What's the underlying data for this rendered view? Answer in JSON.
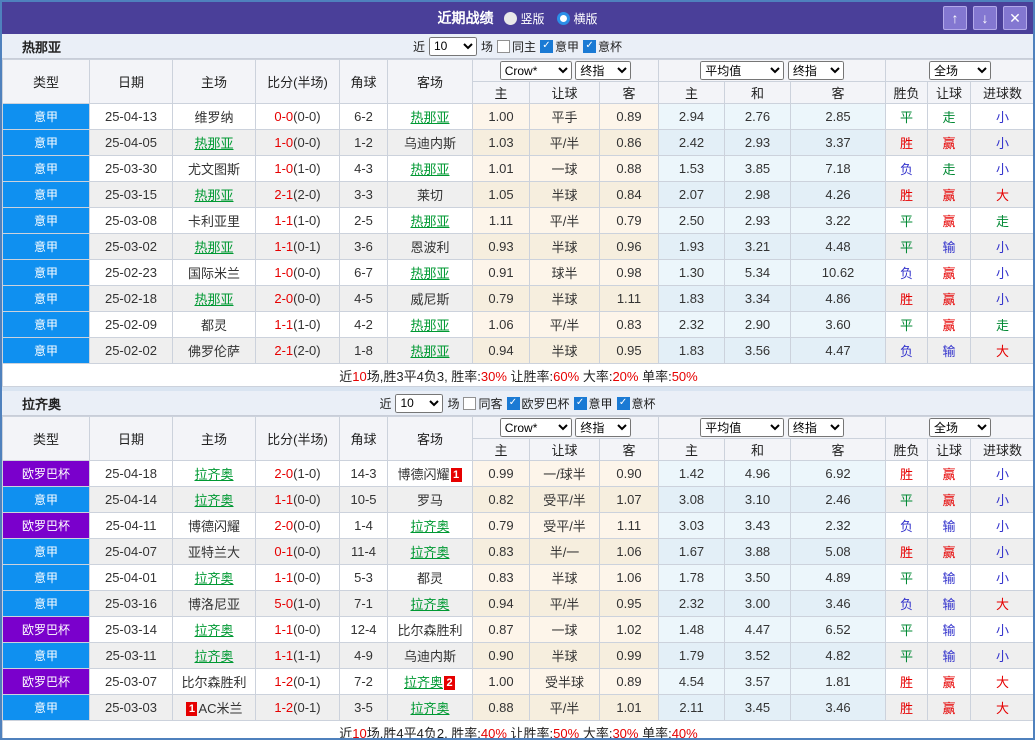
{
  "titlebar": {
    "title": "近期战绩",
    "radios": [
      {
        "label": "竖版",
        "checked": false
      },
      {
        "label": "横版",
        "checked": true
      }
    ],
    "buttons": [
      {
        "name": "move-up",
        "glyph": "↑"
      },
      {
        "name": "move-down",
        "glyph": "↓"
      },
      {
        "name": "close",
        "glyph": "✕"
      }
    ]
  },
  "columns": [
    "类型",
    "日期",
    "主场",
    "比分(半场)",
    "角球",
    "客场",
    "主",
    "让球",
    "客",
    "主",
    "和",
    "客",
    "胜负",
    "让球",
    "进球数"
  ],
  "header_dropdowns": {
    "odds_source": "Crow*",
    "odds_stage": "终指",
    "avg_source": "平均值",
    "avg_stage": "终指",
    "result_scope": "全场"
  },
  "type_colors": {
    "意甲": "#0f90f0",
    "欧罗巴杯": "#7a00cc"
  },
  "status_colors": {
    "r": "#e60000",
    "g": "#008833",
    "b": "#3333cc",
    "team_focus": "#009933"
  },
  "sections": [
    {
      "team": "热那亚",
      "filter": {
        "prefix": "近",
        "count": "10",
        "suffix": "场",
        "checkboxes": [
          {
            "label": "同主",
            "checked": false
          },
          {
            "label": "意甲",
            "checked": true
          },
          {
            "label": "意杯",
            "checked": true
          }
        ]
      },
      "rows": [
        {
          "type": "意甲",
          "date": "25-04-13",
          "home": {
            "n": "维罗纳"
          },
          "score": "0-0",
          "half": "(0-0)",
          "corner": "6-2",
          "away": {
            "n": "热那亚",
            "f": 1
          },
          "odds": [
            "1.00",
            "平手",
            "0.89"
          ],
          "avg": [
            "2.94",
            "2.76",
            "2.85"
          ],
          "res": [
            [
              "平",
              "g"
            ],
            [
              "走",
              "g"
            ],
            [
              "小",
              "b"
            ]
          ]
        },
        {
          "type": "意甲",
          "date": "25-04-05",
          "home": {
            "n": "热那亚",
            "f": 1
          },
          "score": "1-0",
          "half": "(0-0)",
          "corner": "1-2",
          "away": {
            "n": "乌迪内斯"
          },
          "odds": [
            "1.03",
            "平/半",
            "0.86"
          ],
          "avg": [
            "2.42",
            "2.93",
            "3.37"
          ],
          "res": [
            [
              "胜",
              "r"
            ],
            [
              "赢",
              "r"
            ],
            [
              "小",
              "b"
            ]
          ]
        },
        {
          "type": "意甲",
          "date": "25-03-30",
          "home": {
            "n": "尤文图斯"
          },
          "score": "1-0",
          "half": "(1-0)",
          "corner": "4-3",
          "away": {
            "n": "热那亚",
            "f": 1
          },
          "odds": [
            "1.01",
            "一球",
            "0.88"
          ],
          "avg": [
            "1.53",
            "3.85",
            "7.18"
          ],
          "res": [
            [
              "负",
              "b"
            ],
            [
              "走",
              "g"
            ],
            [
              "小",
              "b"
            ]
          ]
        },
        {
          "type": "意甲",
          "date": "25-03-15",
          "home": {
            "n": "热那亚",
            "f": 1
          },
          "score": "2-1",
          "half": "(2-0)",
          "corner": "3-3",
          "away": {
            "n": "莱切"
          },
          "odds": [
            "1.05",
            "半球",
            "0.84"
          ],
          "avg": [
            "2.07",
            "2.98",
            "4.26"
          ],
          "res": [
            [
              "胜",
              "r"
            ],
            [
              "赢",
              "r"
            ],
            [
              "大",
              "r"
            ]
          ]
        },
        {
          "type": "意甲",
          "date": "25-03-08",
          "home": {
            "n": "卡利亚里"
          },
          "score": "1-1",
          "half": "(1-0)",
          "corner": "2-5",
          "away": {
            "n": "热那亚",
            "f": 1
          },
          "odds": [
            "1.11",
            "平/半",
            "0.79"
          ],
          "avg": [
            "2.50",
            "2.93",
            "3.22"
          ],
          "res": [
            [
              "平",
              "g"
            ],
            [
              "赢",
              "r"
            ],
            [
              "走",
              "g"
            ]
          ]
        },
        {
          "type": "意甲",
          "date": "25-03-02",
          "home": {
            "n": "热那亚",
            "f": 1
          },
          "score": "1-1",
          "half": "(0-1)",
          "corner": "3-6",
          "away": {
            "n": "恩波利"
          },
          "odds": [
            "0.93",
            "半球",
            "0.96"
          ],
          "avg": [
            "1.93",
            "3.21",
            "4.48"
          ],
          "res": [
            [
              "平",
              "g"
            ],
            [
              "输",
              "b"
            ],
            [
              "小",
              "b"
            ]
          ]
        },
        {
          "type": "意甲",
          "date": "25-02-23",
          "home": {
            "n": "国际米兰"
          },
          "score": "1-0",
          "half": "(0-0)",
          "corner": "6-7",
          "away": {
            "n": "热那亚",
            "f": 1
          },
          "odds": [
            "0.91",
            "球半",
            "0.98"
          ],
          "avg": [
            "1.30",
            "5.34",
            "10.62"
          ],
          "res": [
            [
              "负",
              "b"
            ],
            [
              "赢",
              "r"
            ],
            [
              "小",
              "b"
            ]
          ]
        },
        {
          "type": "意甲",
          "date": "25-02-18",
          "home": {
            "n": "热那亚",
            "f": 1
          },
          "score": "2-0",
          "half": "(0-0)",
          "corner": "4-5",
          "away": {
            "n": "威尼斯"
          },
          "odds": [
            "0.79",
            "半球",
            "1.11"
          ],
          "avg": [
            "1.83",
            "3.34",
            "4.86"
          ],
          "res": [
            [
              "胜",
              "r"
            ],
            [
              "赢",
              "r"
            ],
            [
              "小",
              "b"
            ]
          ]
        },
        {
          "type": "意甲",
          "date": "25-02-09",
          "home": {
            "n": "都灵"
          },
          "score": "1-1",
          "half": "(1-0)",
          "corner": "4-2",
          "away": {
            "n": "热那亚",
            "f": 1
          },
          "odds": [
            "1.06",
            "平/半",
            "0.83"
          ],
          "avg": [
            "2.32",
            "2.90",
            "3.60"
          ],
          "res": [
            [
              "平",
              "g"
            ],
            [
              "赢",
              "r"
            ],
            [
              "走",
              "g"
            ]
          ]
        },
        {
          "type": "意甲",
          "date": "25-02-02",
          "home": {
            "n": "佛罗伦萨"
          },
          "score": "2-1",
          "half": "(2-0)",
          "corner": "1-8",
          "away": {
            "n": "热那亚",
            "f": 1
          },
          "odds": [
            "0.94",
            "半球",
            "0.95"
          ],
          "avg": [
            "1.83",
            "3.56",
            "4.47"
          ],
          "res": [
            [
              "负",
              "b"
            ],
            [
              "输",
              "b"
            ],
            [
              "大",
              "r"
            ]
          ]
        }
      ],
      "summary": [
        [
          "近",
          0
        ],
        [
          "10",
          1
        ],
        [
          "场,胜3平4负3, 胜率:",
          0
        ],
        [
          "30%",
          1
        ],
        [
          " 让胜率:",
          0
        ],
        [
          "60%",
          1
        ],
        [
          " 大率:",
          0
        ],
        [
          "20%",
          1
        ],
        [
          " 单率:",
          0
        ],
        [
          "50%",
          1
        ]
      ]
    },
    {
      "team": "拉齐奥",
      "filter": {
        "prefix": "近",
        "count": "10",
        "suffix": "场",
        "checkboxes": [
          {
            "label": "同客",
            "checked": false
          },
          {
            "label": "欧罗巴杯",
            "checked": true
          },
          {
            "label": "意甲",
            "checked": true
          },
          {
            "label": "意杯",
            "checked": true
          }
        ]
      },
      "rows": [
        {
          "type": "欧罗巴杯",
          "date": "25-04-18",
          "home": {
            "n": "拉齐奥",
            "f": 1
          },
          "score": "2-0",
          "half": "(1-0)",
          "corner": "14-3",
          "away": {
            "n": "博德闪耀",
            "badge": "1",
            "bp": "after"
          },
          "odds": [
            "0.99",
            "一/球半",
            "0.90"
          ],
          "avg": [
            "1.42",
            "4.96",
            "6.92"
          ],
          "res": [
            [
              "胜",
              "r"
            ],
            [
              "赢",
              "r"
            ],
            [
              "小",
              "b"
            ]
          ]
        },
        {
          "type": "意甲",
          "date": "25-04-14",
          "home": {
            "n": "拉齐奥",
            "f": 1
          },
          "score": "1-1",
          "half": "(0-0)",
          "corner": "10-5",
          "away": {
            "n": "罗马"
          },
          "odds": [
            "0.82",
            "受平/半",
            "1.07"
          ],
          "avg": [
            "3.08",
            "3.10",
            "2.46"
          ],
          "res": [
            [
              "平",
              "g"
            ],
            [
              "赢",
              "r"
            ],
            [
              "小",
              "b"
            ]
          ]
        },
        {
          "type": "欧罗巴杯",
          "date": "25-04-11",
          "home": {
            "n": "博德闪耀"
          },
          "score": "2-0",
          "half": "(0-0)",
          "corner": "1-4",
          "away": {
            "n": "拉齐奥",
            "f": 1
          },
          "odds": [
            "0.79",
            "受平/半",
            "1.11"
          ],
          "avg": [
            "3.03",
            "3.43",
            "2.32"
          ],
          "res": [
            [
              "负",
              "b"
            ],
            [
              "输",
              "b"
            ],
            [
              "小",
              "b"
            ]
          ]
        },
        {
          "type": "意甲",
          "date": "25-04-07",
          "home": {
            "n": "亚特兰大"
          },
          "score": "0-1",
          "half": "(0-0)",
          "corner": "11-4",
          "away": {
            "n": "拉齐奥",
            "f": 1
          },
          "odds": [
            "0.83",
            "半/一",
            "1.06"
          ],
          "avg": [
            "1.67",
            "3.88",
            "5.08"
          ],
          "res": [
            [
              "胜",
              "r"
            ],
            [
              "赢",
              "r"
            ],
            [
              "小",
              "b"
            ]
          ]
        },
        {
          "type": "意甲",
          "date": "25-04-01",
          "home": {
            "n": "拉齐奥",
            "f": 1
          },
          "score": "1-1",
          "half": "(0-0)",
          "corner": "5-3",
          "away": {
            "n": "都灵"
          },
          "odds": [
            "0.83",
            "半球",
            "1.06"
          ],
          "avg": [
            "1.78",
            "3.50",
            "4.89"
          ],
          "res": [
            [
              "平",
              "g"
            ],
            [
              "输",
              "b"
            ],
            [
              "小",
              "b"
            ]
          ]
        },
        {
          "type": "意甲",
          "date": "25-03-16",
          "home": {
            "n": "博洛尼亚"
          },
          "score": "5-0",
          "half": "(1-0)",
          "corner": "7-1",
          "away": {
            "n": "拉齐奥",
            "f": 1
          },
          "odds": [
            "0.94",
            "平/半",
            "0.95"
          ],
          "avg": [
            "2.32",
            "3.00",
            "3.46"
          ],
          "res": [
            [
              "负",
              "b"
            ],
            [
              "输",
              "b"
            ],
            [
              "大",
              "r"
            ]
          ]
        },
        {
          "type": "欧罗巴杯",
          "date": "25-03-14",
          "home": {
            "n": "拉齐奥",
            "f": 1
          },
          "score": "1-1",
          "half": "(0-0)",
          "corner": "12-4",
          "away": {
            "n": "比尔森胜利"
          },
          "odds": [
            "0.87",
            "一球",
            "1.02"
          ],
          "avg": [
            "1.48",
            "4.47",
            "6.52"
          ],
          "res": [
            [
              "平",
              "g"
            ],
            [
              "输",
              "b"
            ],
            [
              "小",
              "b"
            ]
          ]
        },
        {
          "type": "意甲",
          "date": "25-03-11",
          "home": {
            "n": "拉齐奥",
            "f": 1
          },
          "score": "1-1",
          "half": "(1-1)",
          "corner": "4-9",
          "away": {
            "n": "乌迪内斯"
          },
          "odds": [
            "0.90",
            "半球",
            "0.99"
          ],
          "avg": [
            "1.79",
            "3.52",
            "4.82"
          ],
          "res": [
            [
              "平",
              "g"
            ],
            [
              "输",
              "b"
            ],
            [
              "小",
              "b"
            ]
          ]
        },
        {
          "type": "欧罗巴杯",
          "date": "25-03-07",
          "home": {
            "n": "比尔森胜利"
          },
          "score": "1-2",
          "half": "(0-1)",
          "corner": "7-2",
          "away": {
            "n": "拉齐奥",
            "f": 1,
            "badge": "2",
            "bp": "after"
          },
          "odds": [
            "1.00",
            "受半球",
            "0.89"
          ],
          "avg": [
            "4.54",
            "3.57",
            "1.81"
          ],
          "res": [
            [
              "胜",
              "r"
            ],
            [
              "赢",
              "r"
            ],
            [
              "大",
              "r"
            ]
          ]
        },
        {
          "type": "意甲",
          "date": "25-03-03",
          "home": {
            "n": "AC米兰",
            "badge": "1",
            "bp": "before"
          },
          "score": "1-2",
          "half": "(0-1)",
          "corner": "3-5",
          "away": {
            "n": "拉齐奥",
            "f": 1
          },
          "odds": [
            "0.88",
            "平/半",
            "1.01"
          ],
          "avg": [
            "2.11",
            "3.45",
            "3.46"
          ],
          "res": [
            [
              "胜",
              "r"
            ],
            [
              "赢",
              "r"
            ],
            [
              "大",
              "r"
            ]
          ]
        }
      ],
      "summary": [
        [
          "近",
          0
        ],
        [
          "10",
          1
        ],
        [
          "场,胜4平4负2, 胜率:",
          0
        ],
        [
          "40%",
          1
        ],
        [
          " 让胜率:",
          0
        ],
        [
          "50%",
          1
        ],
        [
          " 大率:",
          0
        ],
        [
          "30%",
          1
        ],
        [
          " 单率:",
          0
        ],
        [
          "40%",
          1
        ]
      ]
    }
  ]
}
